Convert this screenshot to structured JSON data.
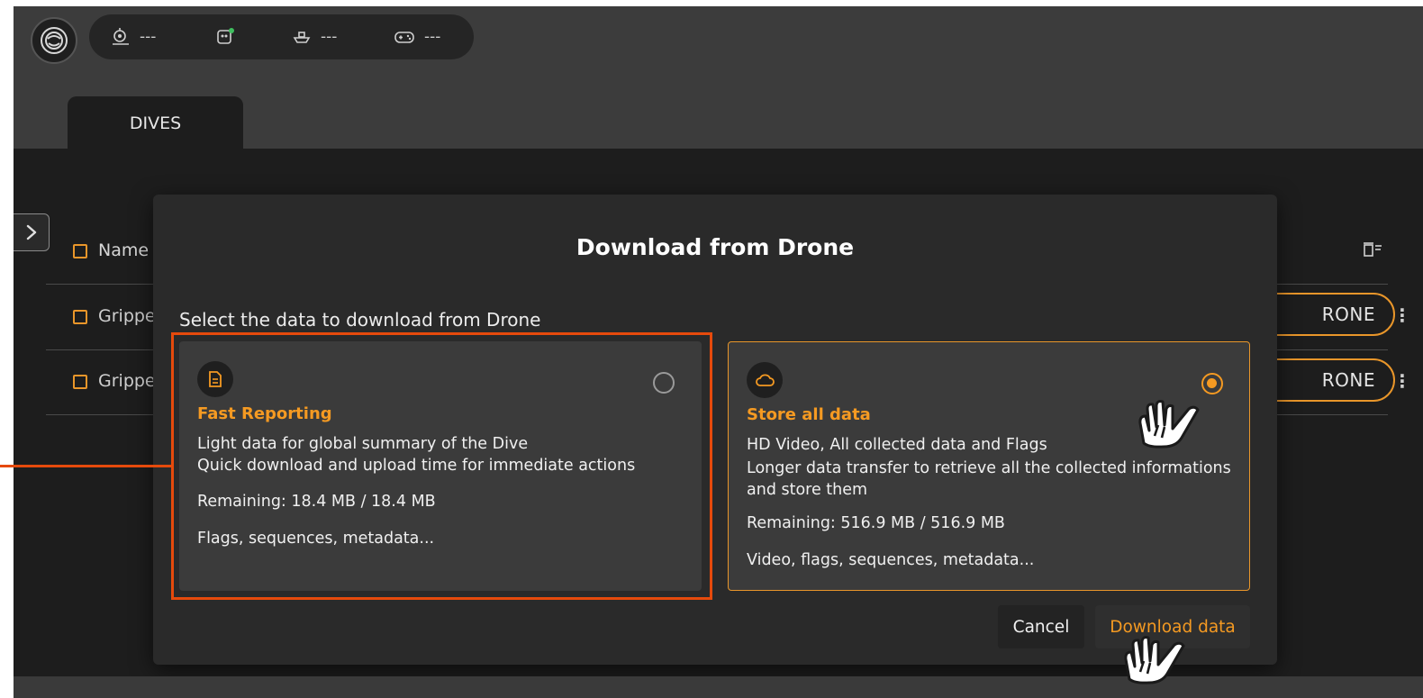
{
  "topbar": {
    "status_items": [
      {
        "icon": "drone-position-icon",
        "value": "---"
      },
      {
        "icon": "sensor-status-icon",
        "value": ""
      },
      {
        "icon": "boat-icon",
        "value": "---"
      },
      {
        "icon": "gamepad-icon",
        "value": "---"
      }
    ]
  },
  "tabs": [
    {
      "label": "DIVES"
    }
  ],
  "table": {
    "header": {
      "name_label": "Name"
    },
    "rows": [
      {
        "name": "Gripper",
        "action_label": "RONE"
      },
      {
        "name": "Gripper",
        "action_label": "RONE"
      }
    ]
  },
  "dialog": {
    "title": "Download from Drone",
    "subtitle": "Select the data to download from Drone",
    "options": [
      {
        "title": "Fast Reporting",
        "desc_line1": "Light data for global summary of the Dive",
        "desc_line2": "Quick download and upload time for immediate actions",
        "remaining": "Remaining: 18.4 MB / 18.4 MB",
        "contents": "Flags, sequences, metadata...",
        "selected": false
      },
      {
        "title": "Store all data",
        "desc_line1": "HD Video, All collected data and Flags",
        "desc_line2": "Longer data transfer to retrieve all the collected informations and store them",
        "remaining": "Remaining: 516.9 MB / 516.9 MB",
        "contents": "Video, flags, sequences, metadata...",
        "selected": true
      }
    ],
    "cancel_label": "Cancel",
    "download_label": "Download data"
  },
  "colors": {
    "accent": "#f59a22",
    "annotation": "#e64a0c",
    "background": "#1d1d1d",
    "topbar": "#3c3c3c"
  }
}
